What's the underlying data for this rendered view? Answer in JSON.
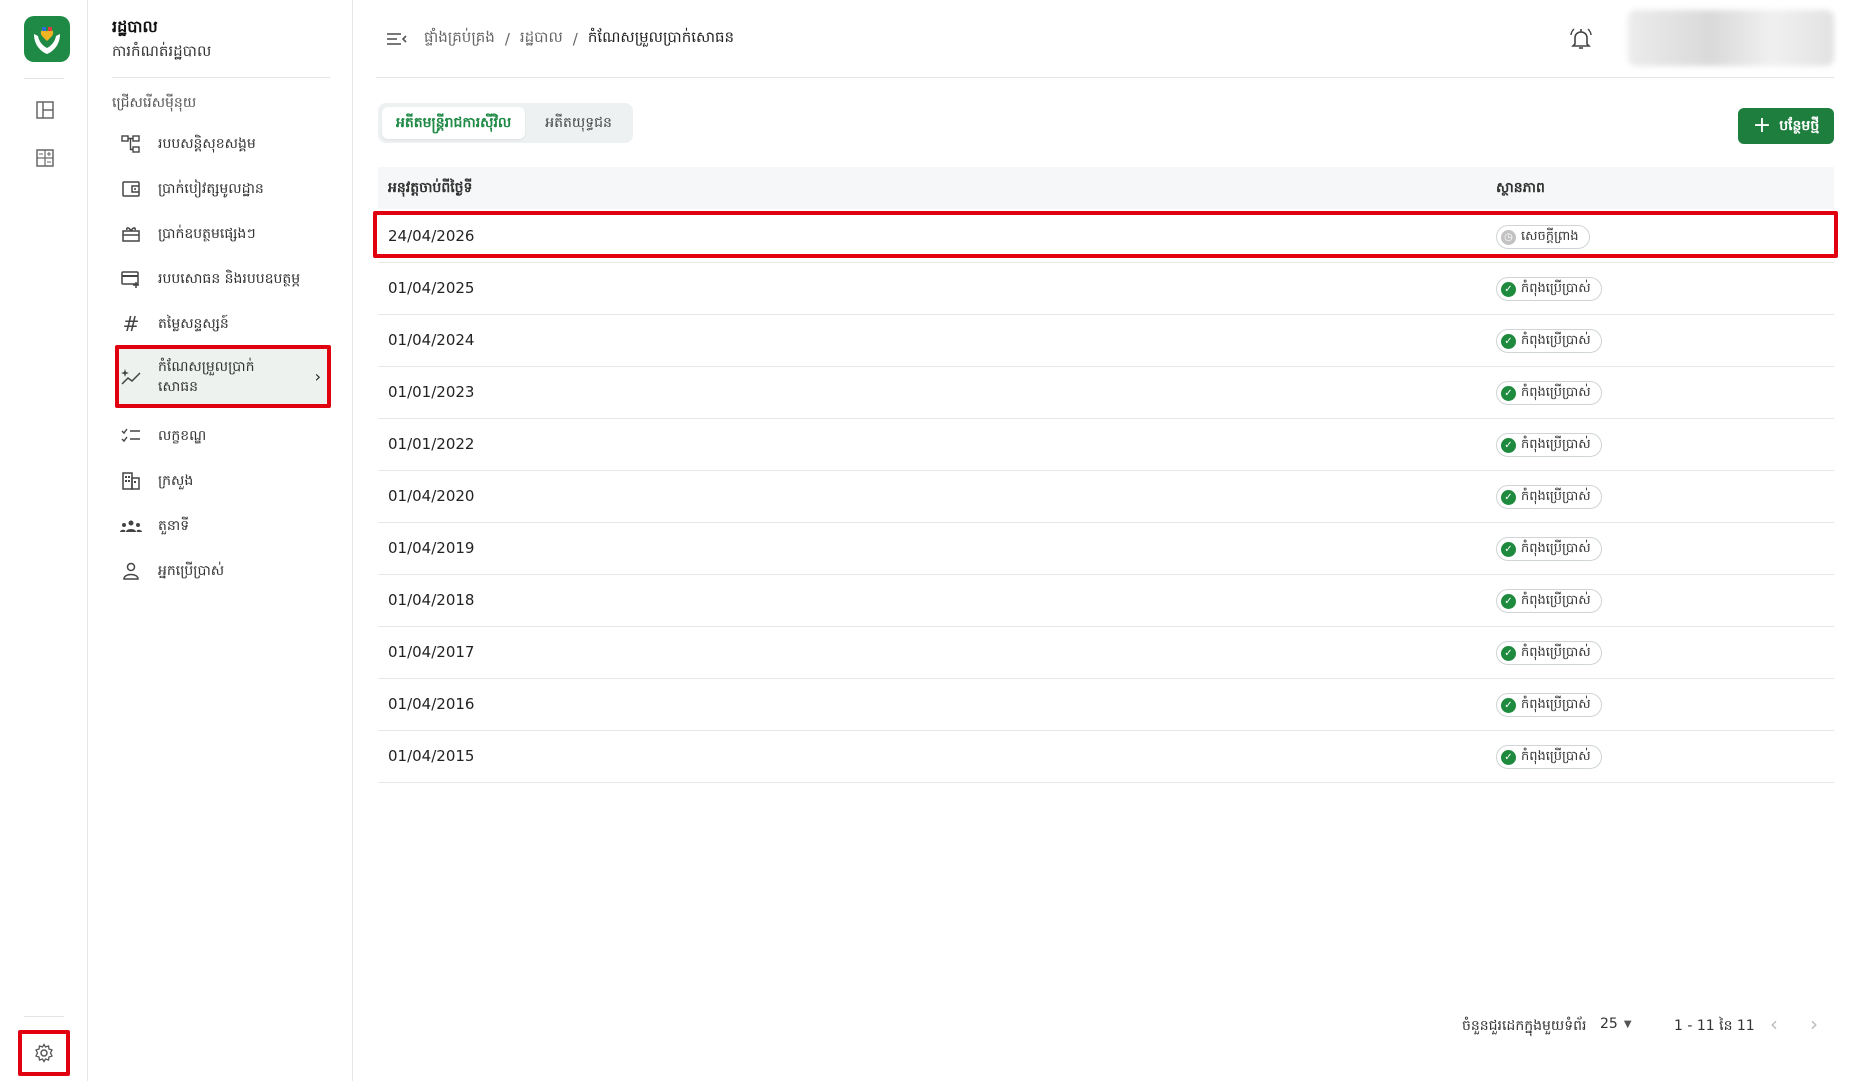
{
  "colors": {
    "brand": "#1f8a46",
    "primary_button": "#1e7e3e",
    "highlight": "#e1000f",
    "active_status": "#1e8a3e"
  },
  "sidebar": {
    "title": "រដ្ឋបាល",
    "subtitle": "ការកំណត់រដ្ឋបាល",
    "section": "ជ្រើសរើសមុីនុយ",
    "items": [
      {
        "label": "របបសន្តិសុខសង្គម",
        "icon": "hierarchy-icon"
      },
      {
        "label": "ប្រាក់បៀវត្សមូលដ្ឋាន",
        "icon": "wallet-icon"
      },
      {
        "label": "ប្រាក់ឧបត្ថមផ្សេងៗ",
        "icon": "gift-icon"
      },
      {
        "label": "របបសោធន និងរបបឧបត្ថម្ភ",
        "icon": "card-add-icon"
      },
      {
        "label": "តម្លៃសន្ទស្សន៍",
        "icon": "hash-icon"
      },
      {
        "label": "កំណែសម្រួលប្រាក់សោធន",
        "icon": "trend-sparkle-icon"
      },
      {
        "label": "លក្ខខណ្ឌ",
        "icon": "checklist-icon"
      },
      {
        "label": "ក្រសួង",
        "icon": "building-icon"
      },
      {
        "label": "តួនាទី",
        "icon": "group-icon"
      },
      {
        "label": "អ្នកប្រើប្រាស់",
        "icon": "user-icon"
      }
    ]
  },
  "breadcrumb": [
    "ផ្ទាំងគ្រប់គ្រង",
    "រដ្ឋបាល",
    "កំណែសម្រួលប្រាក់សោធន"
  ],
  "tabs": [
    {
      "label": "អតីតមន្ត្រីរាជការស៊ីវិល",
      "active": true
    },
    {
      "label": "អតីតយុទ្ធជន",
      "active": false
    }
  ],
  "add_button": "បន្ថែមថ្មី",
  "table": {
    "columns": [
      "អនុវត្តចាប់ពីថ្ងៃទី",
      "ស្ថានភាព"
    ],
    "rows": [
      {
        "date": "24/04/2026",
        "status": "សេចក្តីព្រាង",
        "kind": "draft"
      },
      {
        "date": "01/04/2025",
        "status": "កំពុងប្រើប្រាស់",
        "kind": "active"
      },
      {
        "date": "01/04/2024",
        "status": "កំពុងប្រើប្រាស់",
        "kind": "active"
      },
      {
        "date": "01/01/2023",
        "status": "កំពុងប្រើប្រាស់",
        "kind": "active"
      },
      {
        "date": "01/01/2022",
        "status": "កំពុងប្រើប្រាស់",
        "kind": "active"
      },
      {
        "date": "01/04/2020",
        "status": "កំពុងប្រើប្រាស់",
        "kind": "active"
      },
      {
        "date": "01/04/2019",
        "status": "កំពុងប្រើប្រាស់",
        "kind": "active"
      },
      {
        "date": "01/04/2018",
        "status": "កំពុងប្រើប្រាស់",
        "kind": "active"
      },
      {
        "date": "01/04/2017",
        "status": "កំពុងប្រើប្រាស់",
        "kind": "active"
      },
      {
        "date": "01/04/2016",
        "status": "កំពុងប្រើប្រាស់",
        "kind": "active"
      },
      {
        "date": "01/04/2015",
        "status": "កំពុងប្រើប្រាស់",
        "kind": "active"
      }
    ]
  },
  "footer": {
    "rows_per_page_label": "ចំនួនជួរដេកក្នុងមួយទំព័រ",
    "rows_per_page": "25",
    "range": "1 - 11 នៃ 11"
  }
}
